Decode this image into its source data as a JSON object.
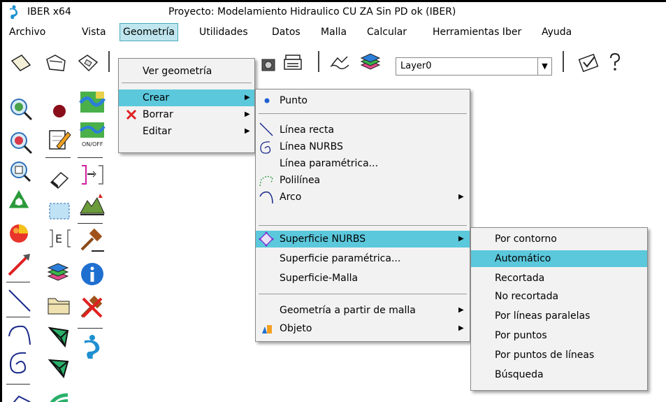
{
  "titlebar": {
    "app_name": "IBER x64",
    "window_title": "Proyecto: Modelamiento Hidraulico CU ZA Sin PD ok (IBER)"
  },
  "menubar": {
    "items": [
      "Archivo",
      "Vista",
      "Geometría",
      "Utilidades",
      "Datos",
      "Malla",
      "Calcular",
      "Herramientas Iber",
      "Ayuda"
    ],
    "active": "Geometría"
  },
  "toolbar": {
    "layer_value": "Layer0",
    "icons": [
      "new-icon",
      "open-icon",
      "save-icon",
      "camera-icon",
      "print-icon",
      "layers-view-icon",
      "layers-icon",
      "check-icon",
      "help-icon"
    ]
  },
  "geometria_menu": {
    "items": [
      {
        "label": "Ver geometría",
        "submenu": false
      },
      {
        "label": "Crear",
        "submenu": true,
        "highlighted": true
      },
      {
        "label": "Borrar",
        "submenu": true,
        "icon": "red-x-icon"
      },
      {
        "label": "Editar",
        "submenu": true
      }
    ]
  },
  "crear_menu": {
    "items": [
      {
        "label": "Punto",
        "icon": "point-icon"
      },
      {
        "label": "Línea recta",
        "icon": "straight-line-icon"
      },
      {
        "label": "Línea NURBS",
        "icon": "nurbs-line-icon"
      },
      {
        "label": "Línea paramétrica..."
      },
      {
        "label": "Polilínea",
        "icon": "polyline-icon"
      },
      {
        "label": "Arco",
        "icon": "arc-icon",
        "submenu": true
      },
      {
        "label": "Superficie NURBS",
        "icon": "nurbs-surface-icon",
        "submenu": true,
        "highlighted": true
      },
      {
        "label": "Superficie  paramétrica..."
      },
      {
        "label": "Superficie-Malla"
      },
      {
        "label": "Geometría a partir de malla",
        "submenu": true
      },
      {
        "label": "Objeto",
        "icon": "object-icon",
        "submenu": true
      }
    ]
  },
  "superficie_menu": {
    "items": [
      {
        "label": "Por contorno"
      },
      {
        "label": "Automático",
        "highlighted": true
      },
      {
        "label": "Recortada"
      },
      {
        "label": "No recortada"
      },
      {
        "label": "Por líneas paralelas"
      },
      {
        "label": "Por puntos"
      },
      {
        "label": "Por puntos de líneas"
      },
      {
        "label": "Búsqueda"
      }
    ]
  },
  "palette": {
    "sublabel_onoff": "ON/OFF",
    "sublabel_e": "E"
  },
  "colors": {
    "highlight": "#5bc8dc",
    "menu_bg": "#f2f2f2"
  }
}
